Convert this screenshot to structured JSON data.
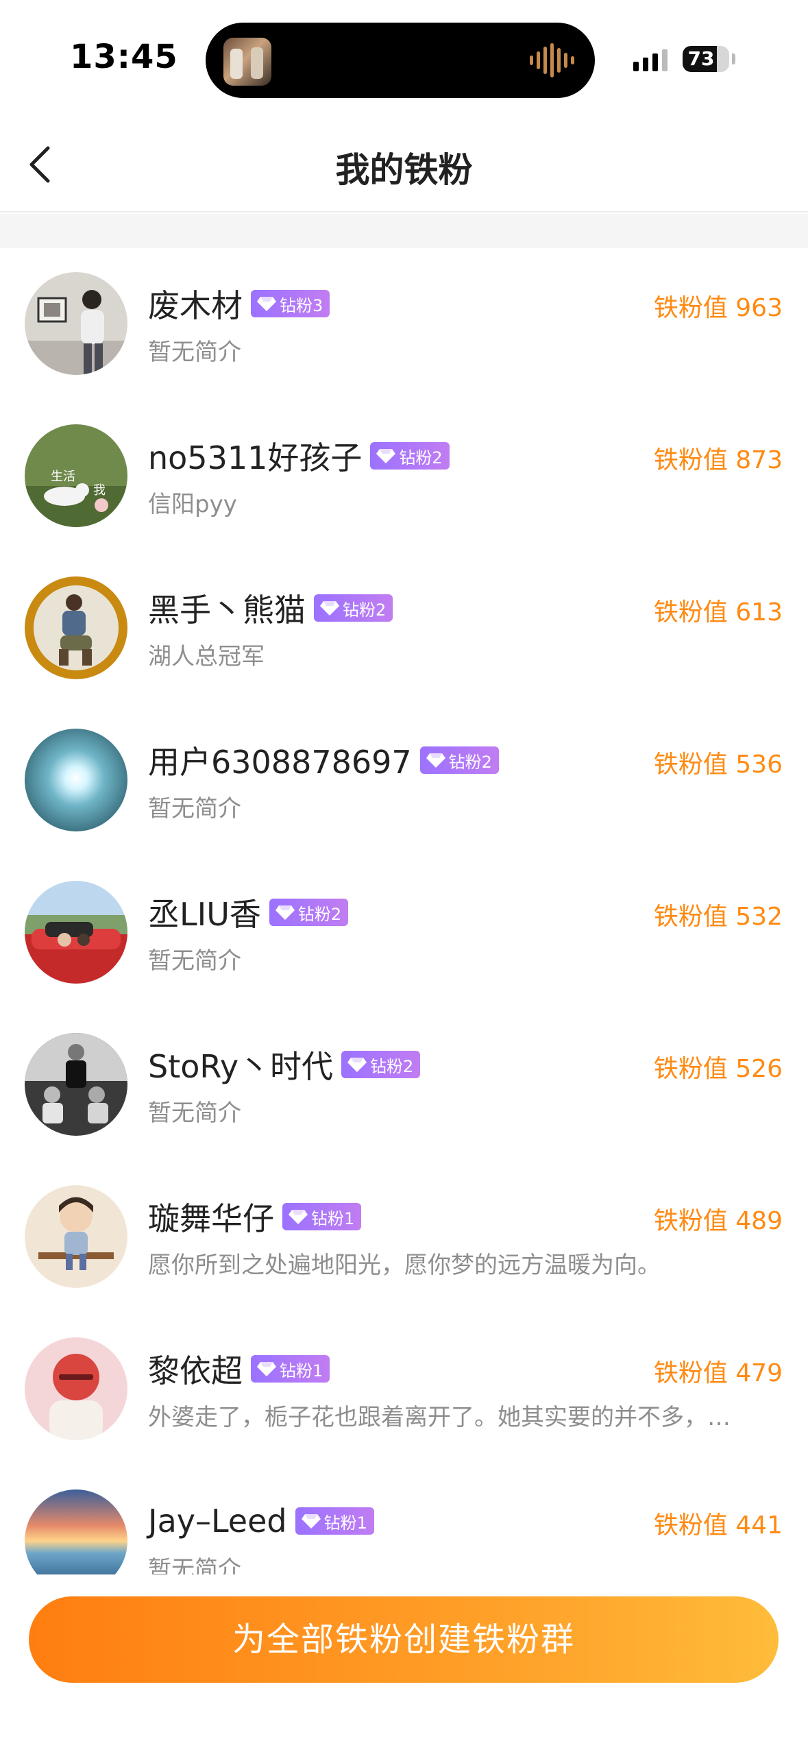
{
  "status_bar": {
    "time": "13:45",
    "battery_level": 73,
    "battery_text": "73"
  },
  "nav": {
    "back_icon": "chevron-left-icon",
    "title": "我的铁粉"
  },
  "fans": [
    {
      "name": "废木材",
      "badge": "钻粉3",
      "bio": "暂无简介",
      "value": "铁粉值 963",
      "avatar": "photo-gallery-selfie"
    },
    {
      "name": "no5311好孩子",
      "badge": "钻粉2",
      "bio": "信阳pyy",
      "value": "铁粉值 873",
      "avatar": "dog-on-grass",
      "avatar_text_1": "生活",
      "avatar_text_2": "我"
    },
    {
      "name": "黑手丶熊猫",
      "badge": "钻粉2",
      "bio": "湖人总冠军",
      "value": "铁粉值 613",
      "avatar": "man-squatting-gold-ring"
    },
    {
      "name": "用户6308878697",
      "badge": "钻粉2",
      "bio": "暂无简介",
      "value": "铁粉值 536",
      "avatar": "light-burst-sky"
    },
    {
      "name": "丞LIU香",
      "badge": "钻粉2",
      "bio": "暂无简介",
      "value": "铁粉值 532",
      "avatar": "red-sports-car"
    },
    {
      "name": "StoRy丶时代",
      "badge": "钻粉2",
      "bio": "暂无简介",
      "value": "铁粉值 526",
      "avatar": "black-white-group"
    },
    {
      "name": "璇舞华仔",
      "badge": "钻粉1",
      "bio": "愿你所到之处遍地阳光，愿你梦的远方温暖为向。",
      "value": "铁粉值 489",
      "avatar": "cartoon-boy"
    },
    {
      "name": "黎依超",
      "badge": "钻粉1",
      "bio": "外婆走了，栀子花也跟着离开了。她其实要的并不多，…",
      "value": "铁粉值 479",
      "avatar": "cartoon-red-face"
    },
    {
      "name": "Jay–Leed",
      "badge": "钻粉1",
      "bio": "暂无简介",
      "value": "铁粉值 441",
      "avatar": "sunset-sea"
    }
  ],
  "bottom": {
    "create_button": "为全部铁粉创建铁粉群"
  },
  "colors": {
    "accent_orange": "#ff8a12",
    "badge_purple": "#a875f7",
    "bio_gray": "#8e8e8e"
  }
}
